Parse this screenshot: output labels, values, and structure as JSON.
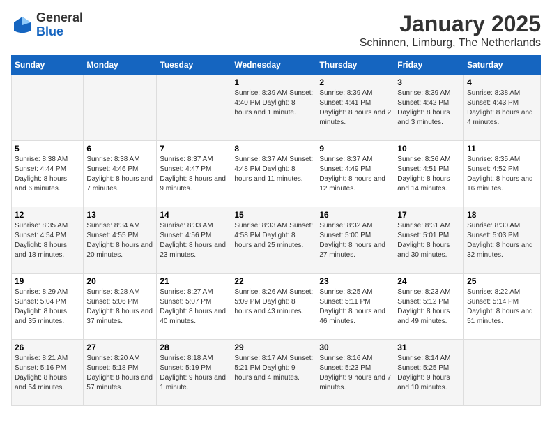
{
  "logo": {
    "general": "General",
    "blue": "Blue"
  },
  "title": "January 2025",
  "subtitle": "Schinnen, Limburg, The Netherlands",
  "days_of_week": [
    "Sunday",
    "Monday",
    "Tuesday",
    "Wednesday",
    "Thursday",
    "Friday",
    "Saturday"
  ],
  "weeks": [
    [
      {
        "day": "",
        "content": ""
      },
      {
        "day": "",
        "content": ""
      },
      {
        "day": "",
        "content": ""
      },
      {
        "day": "1",
        "content": "Sunrise: 8:39 AM\nSunset: 4:40 PM\nDaylight: 8 hours and 1 minute."
      },
      {
        "day": "2",
        "content": "Sunrise: 8:39 AM\nSunset: 4:41 PM\nDaylight: 8 hours and 2 minutes."
      },
      {
        "day": "3",
        "content": "Sunrise: 8:39 AM\nSunset: 4:42 PM\nDaylight: 8 hours and 3 minutes."
      },
      {
        "day": "4",
        "content": "Sunrise: 8:38 AM\nSunset: 4:43 PM\nDaylight: 8 hours and 4 minutes."
      }
    ],
    [
      {
        "day": "5",
        "content": "Sunrise: 8:38 AM\nSunset: 4:44 PM\nDaylight: 8 hours and 6 minutes."
      },
      {
        "day": "6",
        "content": "Sunrise: 8:38 AM\nSunset: 4:46 PM\nDaylight: 8 hours and 7 minutes."
      },
      {
        "day": "7",
        "content": "Sunrise: 8:37 AM\nSunset: 4:47 PM\nDaylight: 8 hours and 9 minutes."
      },
      {
        "day": "8",
        "content": "Sunrise: 8:37 AM\nSunset: 4:48 PM\nDaylight: 8 hours and 11 minutes."
      },
      {
        "day": "9",
        "content": "Sunrise: 8:37 AM\nSunset: 4:49 PM\nDaylight: 8 hours and 12 minutes."
      },
      {
        "day": "10",
        "content": "Sunrise: 8:36 AM\nSunset: 4:51 PM\nDaylight: 8 hours and 14 minutes."
      },
      {
        "day": "11",
        "content": "Sunrise: 8:35 AM\nSunset: 4:52 PM\nDaylight: 8 hours and 16 minutes."
      }
    ],
    [
      {
        "day": "12",
        "content": "Sunrise: 8:35 AM\nSunset: 4:54 PM\nDaylight: 8 hours and 18 minutes."
      },
      {
        "day": "13",
        "content": "Sunrise: 8:34 AM\nSunset: 4:55 PM\nDaylight: 8 hours and 20 minutes."
      },
      {
        "day": "14",
        "content": "Sunrise: 8:33 AM\nSunset: 4:56 PM\nDaylight: 8 hours and 23 minutes."
      },
      {
        "day": "15",
        "content": "Sunrise: 8:33 AM\nSunset: 4:58 PM\nDaylight: 8 hours and 25 minutes."
      },
      {
        "day": "16",
        "content": "Sunrise: 8:32 AM\nSunset: 5:00 PM\nDaylight: 8 hours and 27 minutes."
      },
      {
        "day": "17",
        "content": "Sunrise: 8:31 AM\nSunset: 5:01 PM\nDaylight: 8 hours and 30 minutes."
      },
      {
        "day": "18",
        "content": "Sunrise: 8:30 AM\nSunset: 5:03 PM\nDaylight: 8 hours and 32 minutes."
      }
    ],
    [
      {
        "day": "19",
        "content": "Sunrise: 8:29 AM\nSunset: 5:04 PM\nDaylight: 8 hours and 35 minutes."
      },
      {
        "day": "20",
        "content": "Sunrise: 8:28 AM\nSunset: 5:06 PM\nDaylight: 8 hours and 37 minutes."
      },
      {
        "day": "21",
        "content": "Sunrise: 8:27 AM\nSunset: 5:07 PM\nDaylight: 8 hours and 40 minutes."
      },
      {
        "day": "22",
        "content": "Sunrise: 8:26 AM\nSunset: 5:09 PM\nDaylight: 8 hours and 43 minutes."
      },
      {
        "day": "23",
        "content": "Sunrise: 8:25 AM\nSunset: 5:11 PM\nDaylight: 8 hours and 46 minutes."
      },
      {
        "day": "24",
        "content": "Sunrise: 8:23 AM\nSunset: 5:12 PM\nDaylight: 8 hours and 49 minutes."
      },
      {
        "day": "25",
        "content": "Sunrise: 8:22 AM\nSunset: 5:14 PM\nDaylight: 8 hours and 51 minutes."
      }
    ],
    [
      {
        "day": "26",
        "content": "Sunrise: 8:21 AM\nSunset: 5:16 PM\nDaylight: 8 hours and 54 minutes."
      },
      {
        "day": "27",
        "content": "Sunrise: 8:20 AM\nSunset: 5:18 PM\nDaylight: 8 hours and 57 minutes."
      },
      {
        "day": "28",
        "content": "Sunrise: 8:18 AM\nSunset: 5:19 PM\nDaylight: 9 hours and 1 minute."
      },
      {
        "day": "29",
        "content": "Sunrise: 8:17 AM\nSunset: 5:21 PM\nDaylight: 9 hours and 4 minutes."
      },
      {
        "day": "30",
        "content": "Sunrise: 8:16 AM\nSunset: 5:23 PM\nDaylight: 9 hours and 7 minutes."
      },
      {
        "day": "31",
        "content": "Sunrise: 8:14 AM\nSunset: 5:25 PM\nDaylight: 9 hours and 10 minutes."
      },
      {
        "day": "",
        "content": ""
      }
    ]
  ]
}
